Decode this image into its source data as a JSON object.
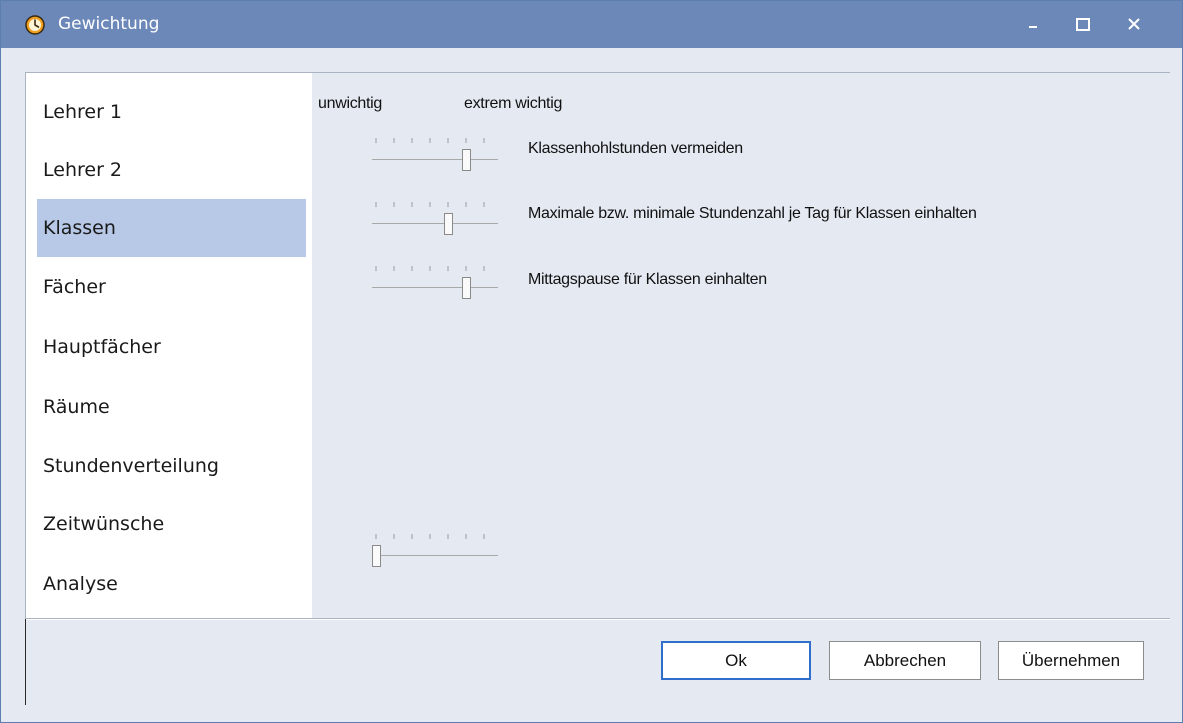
{
  "window": {
    "title": "Gewichtung"
  },
  "titlebar": {
    "minimize": "–",
    "maximize": "☐",
    "close": "✕"
  },
  "sidebar": {
    "selected": "Klassen",
    "items": [
      {
        "label": "Lehrer 1"
      },
      {
        "label": "Lehrer 2"
      },
      {
        "label": "Klassen"
      },
      {
        "label": "Fächer"
      },
      {
        "label": "Hauptfächer"
      },
      {
        "label": "Räume"
      },
      {
        "label": "Stundenverteilung"
      },
      {
        "label": "Zeitwünsche"
      },
      {
        "label": "Analyse"
      }
    ]
  },
  "panel": {
    "scale_low": "unwichtig",
    "scale_high": "extrem wichtig",
    "criteria": [
      {
        "label": "Klassenhohlstunden vermeiden",
        "level": 5,
        "max": 6
      },
      {
        "label": "Maximale bzw. minimale Stundenzahl je Tag für Klassen einhalten",
        "level": 4,
        "max": 6
      },
      {
        "label": "Mittagspause für Klassen einhalten",
        "level": 5,
        "max": 6
      }
    ],
    "unlabeled_slider": {
      "level": 0,
      "max": 6
    }
  },
  "buttons": {
    "ok": "Ok",
    "cancel": "Abbrechen",
    "apply": "Übernehmen"
  },
  "colors": {
    "titlebar": "#6b88b9",
    "selection": "#b8c9e7",
    "panel": "#e4e9f2",
    "focus": "#2f6fcb"
  }
}
